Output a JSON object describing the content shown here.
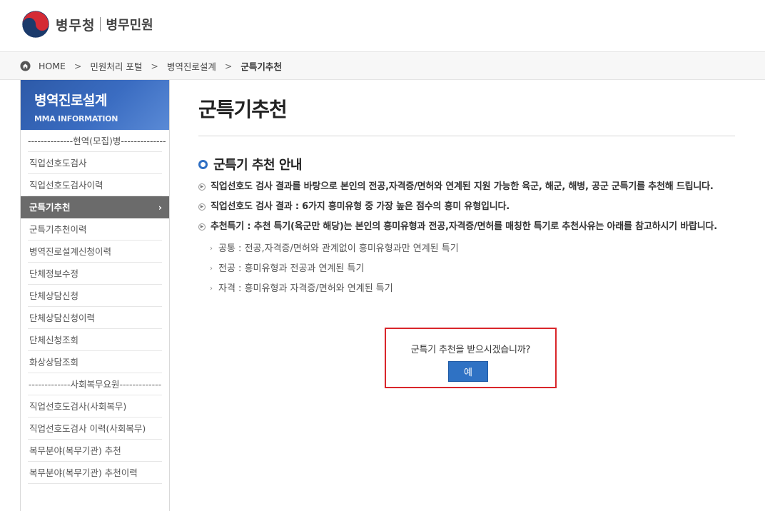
{
  "header": {
    "org_name": "병무청",
    "service_name": "병무민원"
  },
  "breadcrumb": {
    "items": [
      "HOME",
      "민원처리 포털",
      "병역진로설계",
      "군특기추천"
    ],
    "separator": ">"
  },
  "sidebar": {
    "title": "병역진로설계",
    "subtitle": "MMA INFORMATION",
    "items": [
      {
        "label": "--------------현역(모집)병--------------",
        "type": "divider"
      },
      {
        "label": "직업선호도검사"
      },
      {
        "label": "직업선호도검사이력"
      },
      {
        "label": "군특기추천",
        "active": true
      },
      {
        "label": "군특기추천이력"
      },
      {
        "label": "병역진로설계신청이력"
      },
      {
        "label": "단체정보수정"
      },
      {
        "label": "단체상담신청"
      },
      {
        "label": "단체상담신청이력"
      },
      {
        "label": "단체신청조회"
      },
      {
        "label": "화상상담조회"
      },
      {
        "label": "-------------사회복무요원-------------",
        "type": "divider"
      },
      {
        "label": "직업선호도검사(사회복무)"
      },
      {
        "label": "직업선호도검사 이력(사회복무)"
      },
      {
        "label": "복무분야(복무기관) 추천"
      },
      {
        "label": "복무분야(복무기관) 추천이력"
      }
    ],
    "active_chevron": "›"
  },
  "main": {
    "page_title": "군특기추천",
    "section_title": "군특기 추천 안내",
    "bullets": [
      "직업선호도 검사 결과를 바탕으로 본인의 전공,자격증/면허와 연계된 지원 가능한 육군, 해군, 해병, 공군 군특기를 추천해 드립니다.",
      "직업선호도 검사 결과 : 6가지 흥미유형 중 가장 높은 점수의 흥미 유형입니다.",
      "추천특기 : 추천 특기(육군만 해당)는 본인의 흥미유형과 전공,자격증/면허를 매칭한 특기로 추천사유는 아래를 참고하시기 바랍니다."
    ],
    "sub_items": [
      "공통 : 전공,자격증/면허와 관계없이 흥미유형과만 연계된 특기",
      "전공 : 흥미유형과 전공과 연계된 특기",
      "자격 : 흥미유형과 자격증/면허와 연계된 특기"
    ]
  },
  "confirm": {
    "question": "군특기 추천을 받으시겠습니까?",
    "yes_label": "예"
  },
  "colors": {
    "accent_blue": "#2f72c4",
    "sidebar_head": "#3a6cc1",
    "active_item": "#6b6b6b",
    "confirm_border": "#d9262b"
  }
}
